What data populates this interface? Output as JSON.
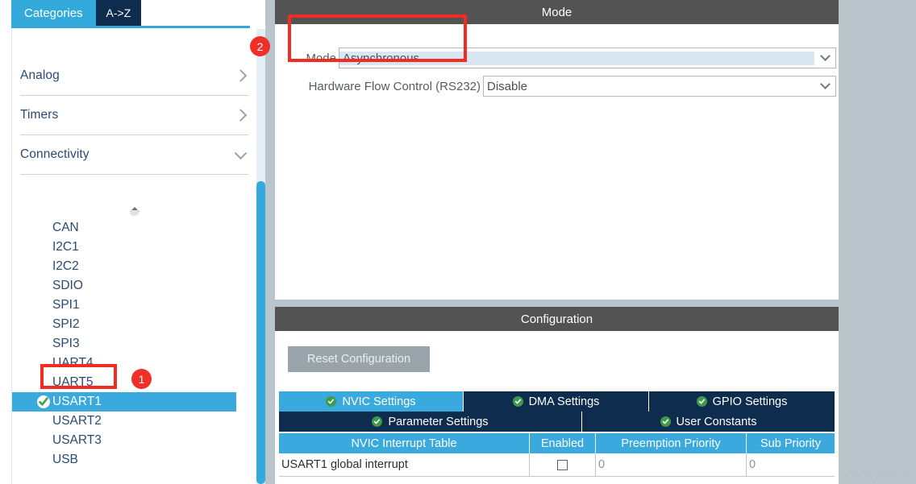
{
  "sidebar": {
    "tabs": [
      {
        "label": "Categories",
        "active": true
      },
      {
        "label": "A->Z",
        "active": false
      }
    ],
    "sections": [
      {
        "label": "Analog",
        "expanded": false,
        "chevron": "chevron-right-icon"
      },
      {
        "label": "Timers",
        "expanded": false,
        "chevron": "chevron-right-icon"
      },
      {
        "label": "Connectivity",
        "expanded": true,
        "chevron": "chevron-down-icon"
      }
    ],
    "scroll_up_icon": "scroll-up-arrow-icon",
    "peripherals": [
      {
        "label": "CAN",
        "selected": false,
        "configured": false
      },
      {
        "label": "I2C1",
        "selected": false,
        "configured": false
      },
      {
        "label": "I2C2",
        "selected": false,
        "configured": false
      },
      {
        "label": "SDIO",
        "selected": false,
        "configured": false
      },
      {
        "label": "SPI1",
        "selected": false,
        "configured": false
      },
      {
        "label": "SPI2",
        "selected": false,
        "configured": false
      },
      {
        "label": "SPI3",
        "selected": false,
        "configured": false
      },
      {
        "label": "UART4",
        "selected": false,
        "configured": false
      },
      {
        "label": "UART5",
        "selected": false,
        "configured": false
      },
      {
        "label": "USART1",
        "selected": true,
        "configured": true
      },
      {
        "label": "USART2",
        "selected": false,
        "configured": false
      },
      {
        "label": "USART3",
        "selected": false,
        "configured": false
      },
      {
        "label": "USB",
        "selected": false,
        "configured": false
      }
    ]
  },
  "mode_panel": {
    "title": "Mode",
    "fields": [
      {
        "label": "Mode",
        "value": "Asynchronous",
        "highlighted": true
      },
      {
        "label": "Hardware Flow Control (RS232)",
        "value": "Disable",
        "highlighted": false
      }
    ]
  },
  "config_panel": {
    "title": "Configuration",
    "reset_button": "Reset Configuration",
    "tabs_row1": [
      {
        "label": "NVIC Settings",
        "active": true
      },
      {
        "label": "DMA Settings",
        "active": false
      },
      {
        "label": "GPIO Settings",
        "active": false
      }
    ],
    "tabs_row2": [
      {
        "label": "Parameter Settings",
        "active": false
      },
      {
        "label": "User Constants",
        "active": false
      }
    ],
    "table": {
      "headers": [
        "NVIC Interrupt Table",
        "Enabled",
        "Preemption Priority",
        "Sub Priority"
      ],
      "rows": [
        {
          "name": "USART1 global interrupt",
          "enabled": false,
          "preemption_priority": "0",
          "sub_priority": "0"
        }
      ]
    }
  },
  "annotations": {
    "badges": [
      {
        "id": "1",
        "label": "1"
      },
      {
        "id": "2",
        "label": "2"
      }
    ],
    "highlight_color": "#f42b21"
  },
  "watermark": "CSDN @Dir_xr",
  "colors": {
    "accent_blue": "#33a9dc",
    "dark_navy": "#0d2c4e",
    "panel_header": "#535353",
    "background_gray": "#b9c4cb",
    "selected_field": "#d9e7f2",
    "green_check": "#3f9a4b",
    "annotation_red": "#f03028"
  }
}
